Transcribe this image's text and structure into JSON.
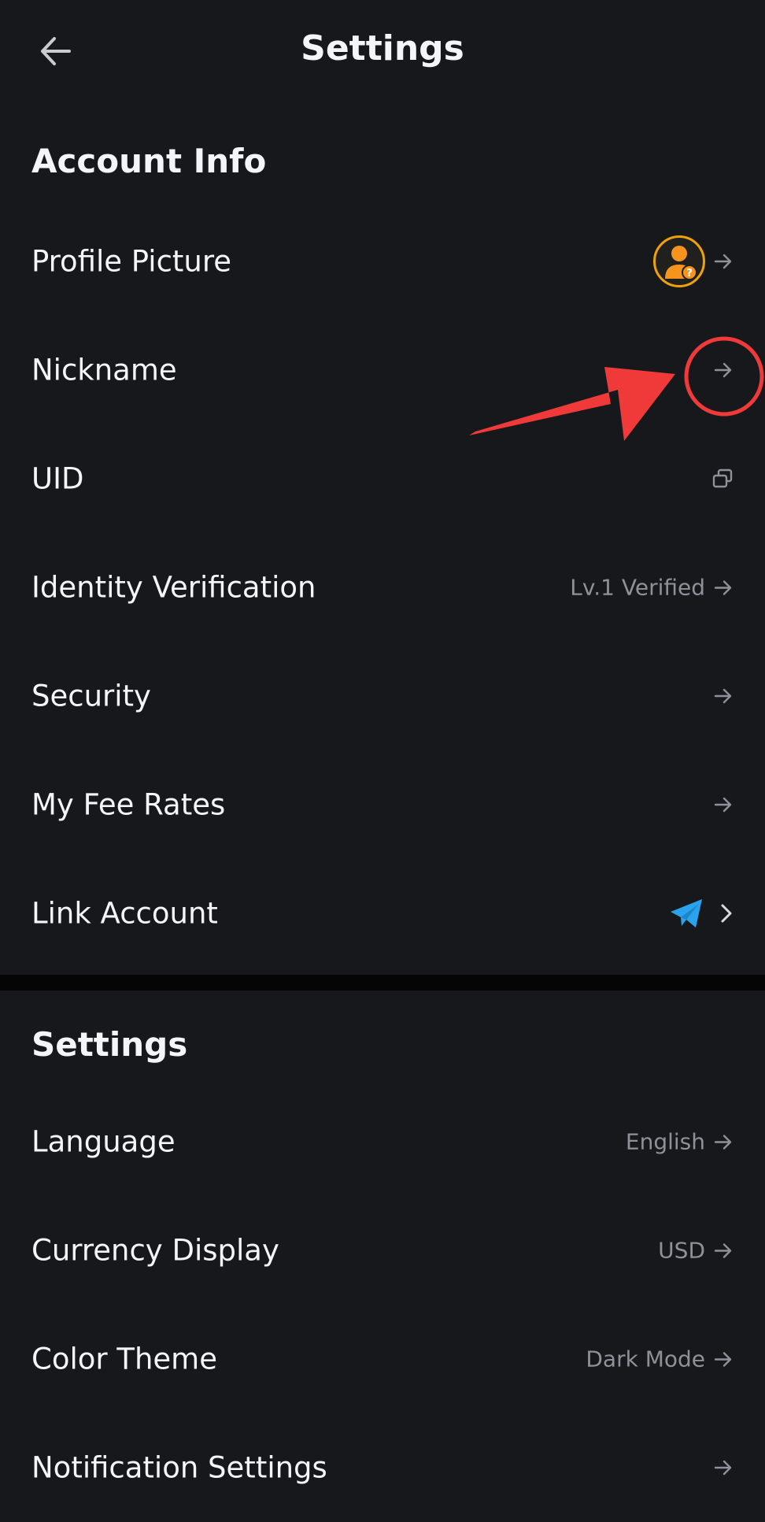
{
  "header": {
    "title": "Settings",
    "back_icon": "arrow-left-icon"
  },
  "account_info": {
    "title": "Account Info",
    "rows": [
      {
        "label": "Profile Picture",
        "value": "",
        "icon": "avatar"
      },
      {
        "label": "Nickname",
        "value": ""
      },
      {
        "label": "UID",
        "value": "",
        "icon": "copy-icon"
      },
      {
        "label": "Identity Verification",
        "value": "Lv.1 Verified"
      },
      {
        "label": "Security",
        "value": ""
      },
      {
        "label": "My Fee Rates",
        "value": ""
      },
      {
        "label": "Link Account",
        "value": "",
        "icon": "telegram-icon"
      }
    ]
  },
  "settings": {
    "title": "Settings",
    "rows": [
      {
        "label": "Language",
        "value": "English"
      },
      {
        "label": "Currency Display",
        "value": "USD"
      },
      {
        "label": "Color Theme",
        "value": "Dark Mode"
      },
      {
        "label": "Notification Settings",
        "value": ""
      }
    ]
  },
  "colors": {
    "background": "#17181c",
    "text_primary": "#f4f5f7",
    "text_secondary": "#8e9199",
    "annotation": "#f03a3a",
    "telegram": "#2aa3ef",
    "avatar_ring": "#f0a200"
  }
}
